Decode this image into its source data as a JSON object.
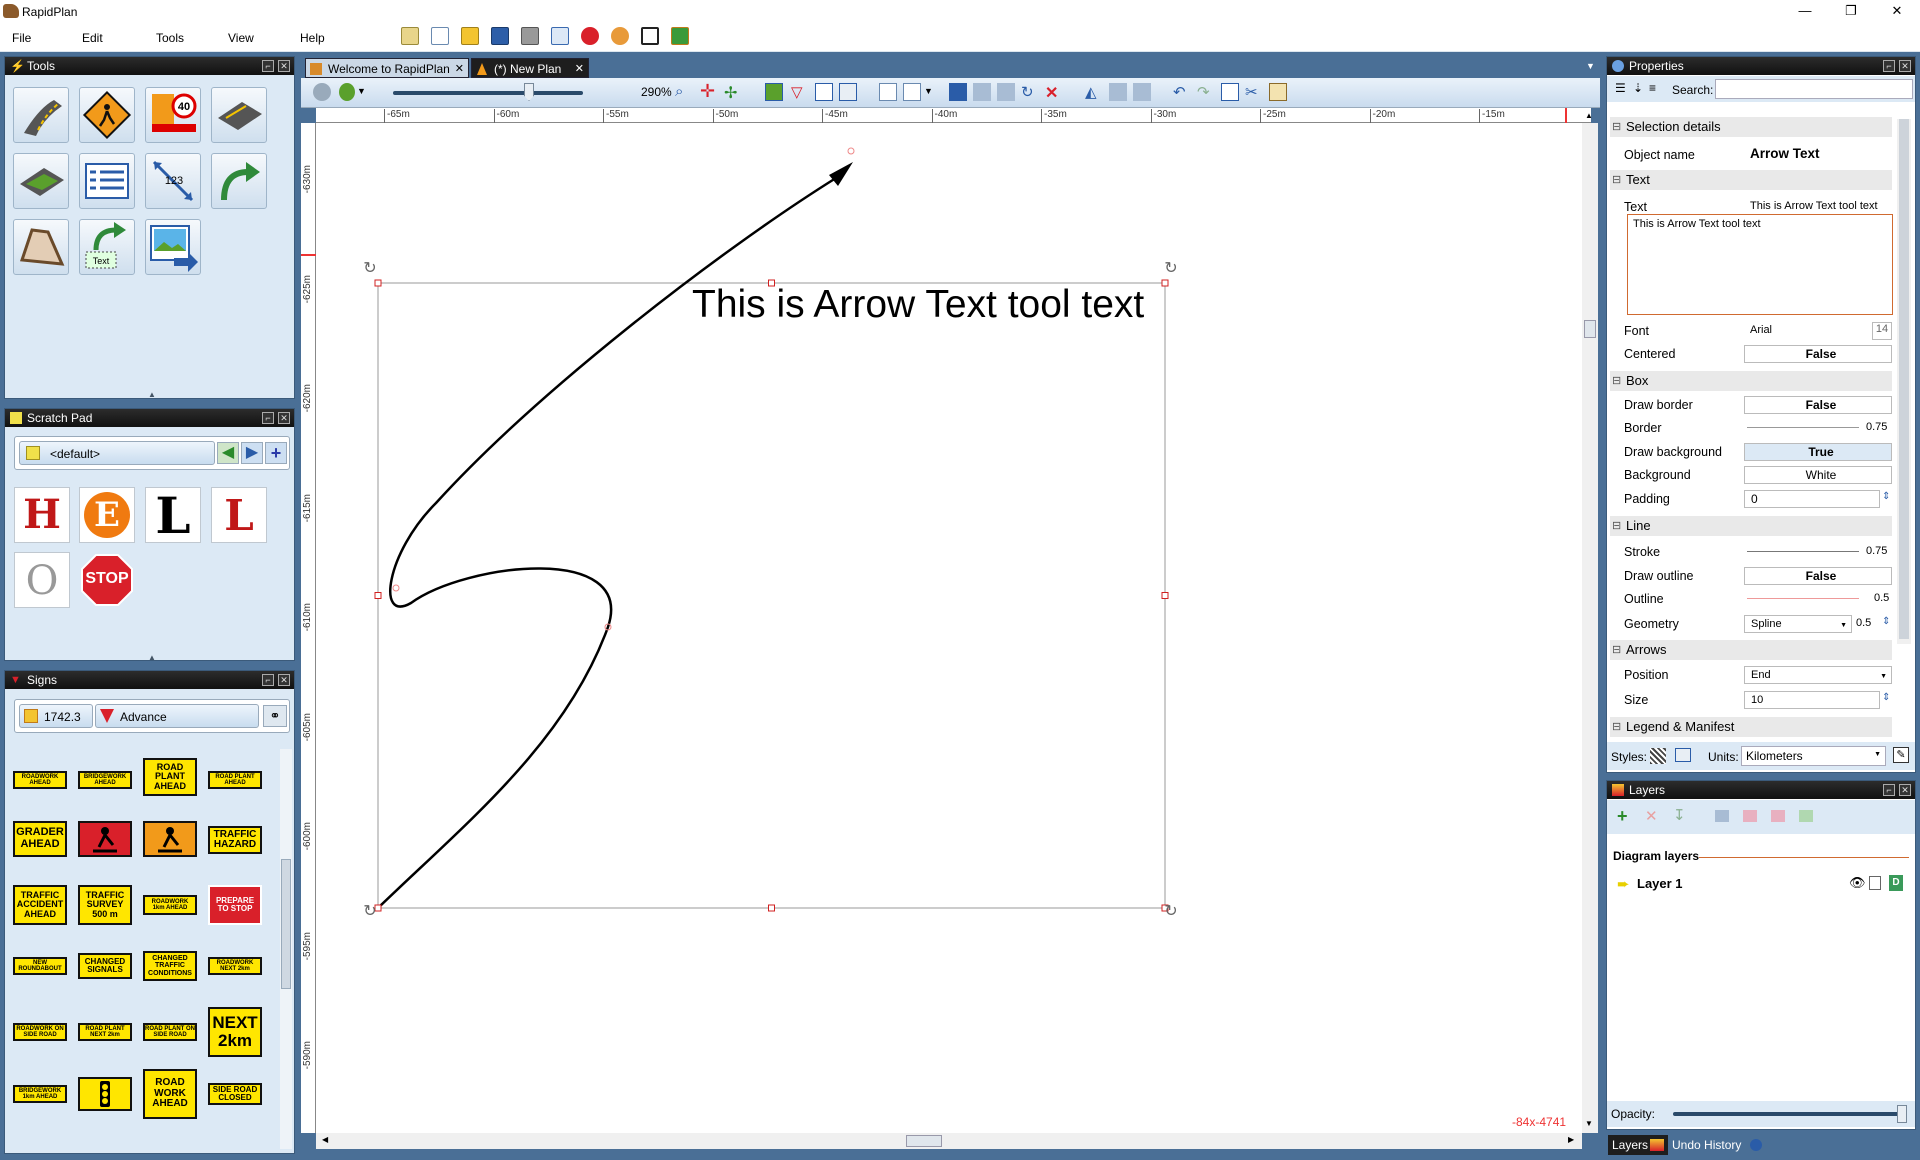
{
  "app": {
    "title": "RapidPlan"
  },
  "menu": [
    "File",
    "Edit",
    "Tools",
    "View",
    "Help"
  ],
  "panels": {
    "tools": {
      "title": "Tools"
    },
    "scratch": {
      "title": "Scratch Pad",
      "library": "<default>",
      "items": [
        "H",
        "E",
        "L",
        "L",
        "O",
        "STOP"
      ]
    },
    "signs": {
      "title": "Signs",
      "standard": "1742.3",
      "category": "Advance"
    }
  },
  "signs": [
    "ROADWORK AHEAD",
    "BRIDGEWORK AHEAD",
    "ROAD PLANT AHEAD",
    "ROAD PLANT AHEAD",
    "GRADER AHEAD",
    "",
    "",
    "TRAFFIC HAZARD",
    "TRAFFIC ACCIDENT AHEAD",
    "TRAFFIC SURVEY 500 m",
    "ROADWORK 1km AHEAD",
    "PREPARE TO STOP",
    "NEW ROUNDABOUT",
    "CHANGED SIGNALS",
    "CHANGED TRAFFIC CONDITIONS",
    "ROADWORK NEXT 2km",
    "ROADWORK ON SIDE ROAD",
    "ROAD PLANT NEXT 2km",
    "ROAD PLANT ON SIDE ROAD",
    "NEXT 2km",
    "BRIDGEWORK 1km AHEAD",
    "",
    "ROAD WORK AHEAD",
    "SIDE ROAD CLOSED"
  ],
  "tabs": [
    {
      "label": "Welcome to RapidPlan",
      "active": false
    },
    {
      "label": "(*) New Plan",
      "active": true
    }
  ],
  "editor": {
    "zoom": "290%",
    "canvas_text": "This is Arrow Text tool text",
    "coords": "-84x-4741"
  },
  "ruler": {
    "h": [
      "-65m",
      "-60m",
      "-55m",
      "-50m",
      "-45m",
      "-40m",
      "-35m",
      "-30m",
      "-25m",
      "-20m",
      "-15m"
    ],
    "v": [
      "-630m",
      "-625m",
      "-620m",
      "-615m",
      "-610m",
      "-605m",
      "-600m",
      "-595m",
      "-590m"
    ]
  },
  "properties": {
    "title": "Properties",
    "search_label": "Search:",
    "sections": {
      "selection": "Selection details",
      "text": "Text",
      "box": "Box",
      "line": "Line",
      "arrows": "Arrows",
      "legend": "Legend & Manifest"
    },
    "object_name_label": "Object name",
    "object_name": "Arrow Text",
    "text_label": "Text",
    "text_value": "This is Arrow Text tool text",
    "font_label": "Font",
    "font_value": "Arial",
    "font_size": "14",
    "centered_label": "Centered",
    "centered": "False",
    "draw_border_label": "Draw border",
    "draw_border": "False",
    "border_label": "Border",
    "border": "0.75",
    "draw_background_label": "Draw background",
    "draw_background": "True",
    "background_label": "Background",
    "background": "White",
    "padding_label": "Padding",
    "padding": "0",
    "stroke_label": "Stroke",
    "stroke": "0.75",
    "draw_outline_label": "Draw outline",
    "draw_outline": "False",
    "outline_label": "Outline",
    "outline": "0.5",
    "geometry_label": "Geometry",
    "geometry": "Spline",
    "geometry_tension": "0.5",
    "position_label": "Position",
    "position": "End",
    "size_label": "Size",
    "size": "10",
    "styles_label": "Styles:",
    "units_label": "Units:",
    "units": "Kilometers"
  },
  "layers": {
    "title": "Layers",
    "group": "Diagram layers",
    "layer": "Layer 1",
    "opacity_label": "Opacity:",
    "bottom_tabs": [
      "Layers",
      "Undo History"
    ]
  },
  "colors": {
    "frame": "#4a6f96",
    "panel": "#dce9f5",
    "header": "#1e1e1e",
    "sign_yellow": "#ffe600"
  }
}
